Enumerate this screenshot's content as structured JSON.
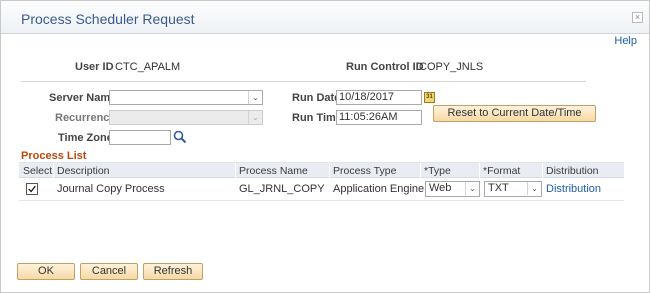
{
  "dialog": {
    "title": "Process Scheduler Request",
    "close_glyph": "×",
    "help_label": "Help"
  },
  "header": {
    "user_id_label": "User ID",
    "user_id_value": "CTC_APALM",
    "run_control_label": "Run Control ID",
    "run_control_value": "COPY_JNLS"
  },
  "form": {
    "server_name_label": "Server Name",
    "server_name_value": "",
    "recurrence_label": "Recurrence",
    "recurrence_value": "",
    "time_zone_label": "Time Zone",
    "time_zone_value": "",
    "run_date_label": "Run Date",
    "run_date_value": "10/18/2017",
    "run_time_label": "Run Time",
    "run_time_value": "11:05:26AM",
    "reset_button_label": "Reset to Current Date/Time",
    "calendar_glyph": "31"
  },
  "process_list": {
    "title": "Process List",
    "columns": [
      "Select",
      "Description",
      "Process Name",
      "Process Type",
      "*Type",
      "*Format",
      "Distribution"
    ],
    "rows": [
      {
        "selected": true,
        "description": "Journal Copy Process",
        "process_name": "GL_JRNL_COPY",
        "process_type": "Application Engine",
        "type": "Web",
        "format": "TXT",
        "distribution": "Distribution"
      }
    ]
  },
  "footer": {
    "ok_label": "OK",
    "cancel_label": "Cancel",
    "refresh_label": "Refresh"
  },
  "colors": {
    "title": "#3a5a8c",
    "grid_title": "#b74a0b",
    "link": "#1c5ea8",
    "button_fill": "#f6d9a5"
  },
  "icons": {
    "close": "close-icon",
    "calendar": "calendar-icon",
    "search": "search-icon",
    "dropdown": "chevron-down-icon",
    "checkbox": "checkbox-checked-icon"
  }
}
